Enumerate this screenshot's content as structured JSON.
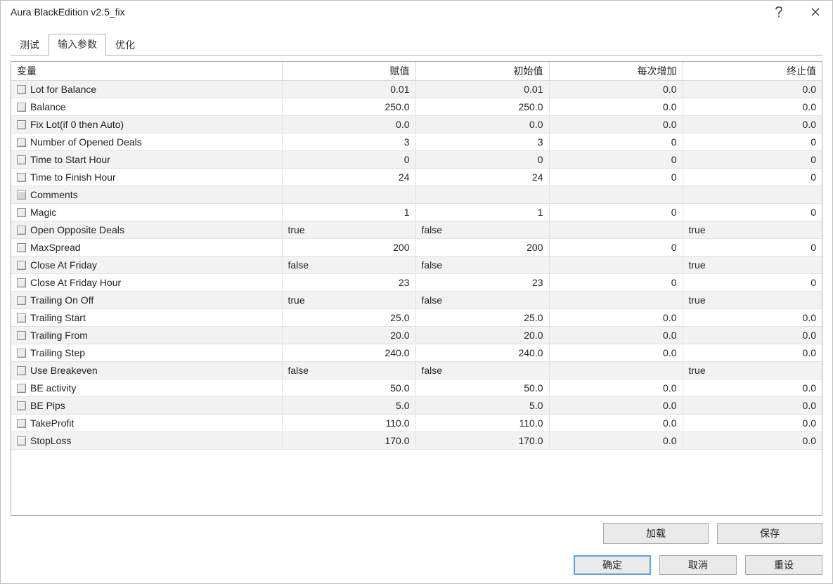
{
  "window": {
    "title": "Aura BlackEdition v2.5_fix"
  },
  "tabs": {
    "test": "测试",
    "inputs": "输入参数",
    "optimize": "优化"
  },
  "columns": {
    "variable": "变量",
    "value": "赋值",
    "initial": "初始值",
    "step": "每次增加",
    "stop": "终止值"
  },
  "rows": [
    {
      "name": "Lot for Balance",
      "value": "0.01",
      "initial": "0.01",
      "step": "0.0",
      "stop": "0.0",
      "valAlign": "num",
      "alt": true
    },
    {
      "name": "Balance",
      "value": "250.0",
      "initial": "250.0",
      "step": "0.0",
      "stop": "0.0",
      "valAlign": "num",
      "alt": false
    },
    {
      "name": "Fix Lot(if 0 then Auto)",
      "value": "0.0",
      "initial": "0.0",
      "step": "0.0",
      "stop": "0.0",
      "valAlign": "num",
      "alt": true
    },
    {
      "name": "Number of Opened Deals",
      "value": "3",
      "initial": "3",
      "step": "0",
      "stop": "0",
      "valAlign": "num",
      "alt": false
    },
    {
      "name": "Time to Start Hour",
      "value": "0",
      "initial": "0",
      "step": "0",
      "stop": "0",
      "valAlign": "num",
      "alt": true
    },
    {
      "name": "Time to Finish Hour",
      "value": "24",
      "initial": "24",
      "step": "0",
      "stop": "0",
      "valAlign": "num",
      "alt": false
    },
    {
      "name": "Comments",
      "value": "",
      "initial": "",
      "step": "",
      "stop": "",
      "valAlign": "txt",
      "alt": true,
      "disabled": true
    },
    {
      "name": "Magic",
      "value": "1",
      "initial": "1",
      "step": "0",
      "stop": "0",
      "valAlign": "num",
      "alt": false
    },
    {
      "name": "Open Opposite Deals",
      "value": "true",
      "initial": "false",
      "step": "",
      "stop": "true",
      "valAlign": "txt",
      "alt": true
    },
    {
      "name": "MaxSpread",
      "value": "200",
      "initial": "200",
      "step": "0",
      "stop": "0",
      "valAlign": "num",
      "alt": false
    },
    {
      "name": "Close At Friday",
      "value": "false",
      "initial": "false",
      "step": "",
      "stop": "true",
      "valAlign": "txt",
      "alt": true
    },
    {
      "name": "Close At Friday Hour",
      "value": "23",
      "initial": "23",
      "step": "0",
      "stop": "0",
      "valAlign": "num",
      "alt": false
    },
    {
      "name": "Trailing On Off",
      "value": "true",
      "initial": "false",
      "step": "",
      "stop": "true",
      "valAlign": "txt",
      "alt": true
    },
    {
      "name": "Trailing Start",
      "value": "25.0",
      "initial": "25.0",
      "step": "0.0",
      "stop": "0.0",
      "valAlign": "num",
      "alt": false
    },
    {
      "name": "Trailing From",
      "value": "20.0",
      "initial": "20.0",
      "step": "0.0",
      "stop": "0.0",
      "valAlign": "num",
      "alt": true
    },
    {
      "name": "Trailing Step",
      "value": "240.0",
      "initial": "240.0",
      "step": "0.0",
      "stop": "0.0",
      "valAlign": "num",
      "alt": false
    },
    {
      "name": "Use Breakeven",
      "value": "false",
      "initial": "false",
      "step": "",
      "stop": "true",
      "valAlign": "txt",
      "alt": true
    },
    {
      "name": "BE activity",
      "value": "50.0",
      "initial": "50.0",
      "step": "0.0",
      "stop": "0.0",
      "valAlign": "num",
      "alt": false
    },
    {
      "name": "BE Pips",
      "value": "5.0",
      "initial": "5.0",
      "step": "0.0",
      "stop": "0.0",
      "valAlign": "num",
      "alt": true
    },
    {
      "name": "TakeProfit",
      "value": "110.0",
      "initial": "110.0",
      "step": "0.0",
      "stop": "0.0",
      "valAlign": "num",
      "alt": false
    },
    {
      "name": "StopLoss",
      "value": "170.0",
      "initial": "170.0",
      "step": "0.0",
      "stop": "0.0",
      "valAlign": "num",
      "alt": true
    }
  ],
  "buttons": {
    "load": "加载",
    "save": "保存",
    "ok": "确定",
    "cancel": "取消",
    "reset": "重设"
  }
}
